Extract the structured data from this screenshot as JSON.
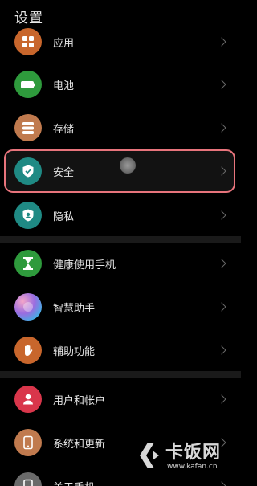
{
  "header": {
    "title": "设置"
  },
  "items": [
    {
      "label": "应用",
      "icon": "apps-icon",
      "color": "#c8662c"
    },
    {
      "label": "电池",
      "icon": "battery-icon",
      "color": "#2e9a3c"
    },
    {
      "label": "存储",
      "icon": "storage-icon",
      "color": "#c07a4e"
    },
    {
      "label": "安全",
      "icon": "shield-check-icon",
      "color": "#1f8a84"
    },
    {
      "label": "隐私",
      "icon": "privacy-icon",
      "color": "#1f8a84"
    },
    {
      "label": "健康使用手机",
      "icon": "hourglass-icon",
      "color": "#2e9a3c"
    },
    {
      "label": "智慧助手",
      "icon": "assistant-icon",
      "color": "#8a6cd8"
    },
    {
      "label": "辅助功能",
      "icon": "hand-icon",
      "color": "#c8662c"
    },
    {
      "label": "用户和帐户",
      "icon": "user-icon",
      "color": "#d9364b"
    },
    {
      "label": "系统和更新",
      "icon": "system-update-icon",
      "color": "#c07a4e"
    },
    {
      "label": "关于手机",
      "icon": "phone-icon",
      "color": "#6a6a6a"
    }
  ],
  "watermark": {
    "text": "卡饭网",
    "url": "www.kafan.cn"
  }
}
